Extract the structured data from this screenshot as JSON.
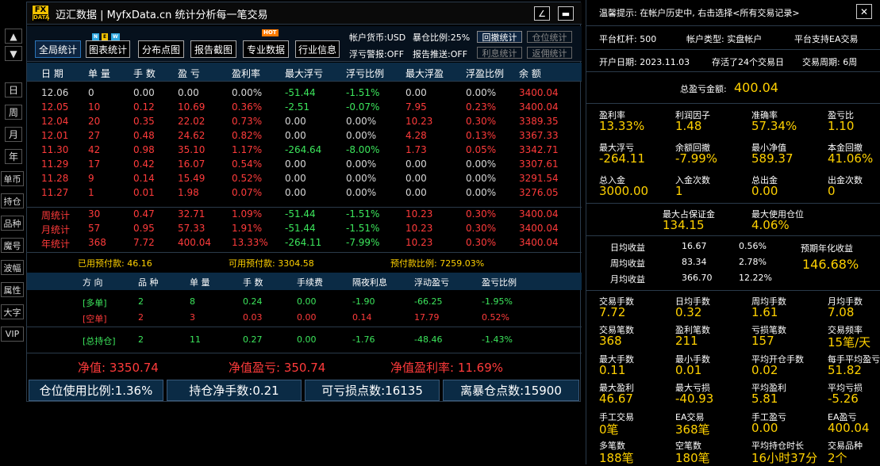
{
  "sidebar": {
    "arrow_up": "▲",
    "arrow_down": "▼",
    "periods": [
      "日",
      "周",
      "月",
      "年"
    ],
    "tools": [
      "单币",
      "持仓",
      "品种",
      "魔号",
      "波幅",
      "属性",
      "大字",
      "VIP"
    ]
  },
  "window": {
    "logo_top": "FX",
    "logo_bottom": "DATA",
    "title": "迈汇数据 | MyfxData.cn  统计分析每一笔交易",
    "min_icon": "∠",
    "max_icon": "▬"
  },
  "toolbar": {
    "buttons": [
      "全局统计",
      "图表统计",
      "分布点图",
      "报告截图",
      "专业数据",
      "行业信息"
    ],
    "new_badge": [
      "N",
      "E",
      "W"
    ],
    "hot_badge": "HOT",
    "currency": "帐户货币:USD",
    "margin_ratio": "暴仓比例:25%",
    "float_alert": "浮亏警报:OFF",
    "report_push": "报告推送:OFF",
    "stat_buttons": [
      "回撤统计",
      "仓位统计",
      "利息统计",
      "返佣统计"
    ]
  },
  "table": {
    "headers": [
      "日 期",
      "单 量",
      "手 数",
      "盈 亏",
      "盈利率",
      "最大浮亏",
      "浮亏比例",
      "最大浮盈",
      "浮盈比例",
      "余 额"
    ],
    "daily": [
      [
        "12.06",
        "0",
        "0.00",
        "0.00",
        "0.00%",
        "-51.44",
        "-1.51%",
        "0.00",
        "0.00%",
        "3400.04"
      ],
      [
        "12.05",
        "10",
        "0.12",
        "10.69",
        "0.36%",
        "-2.51",
        "-0.07%",
        "7.95",
        "0.23%",
        "3400.04"
      ],
      [
        "12.04",
        "20",
        "0.35",
        "22.02",
        "0.73%",
        "0.00",
        "0.00%",
        "10.23",
        "0.30%",
        "3389.35"
      ],
      [
        "12.01",
        "27",
        "0.48",
        "24.62",
        "0.82%",
        "0.00",
        "0.00%",
        "4.28",
        "0.13%",
        "3367.33"
      ],
      [
        "11.30",
        "42",
        "0.98",
        "35.10",
        "1.17%",
        "-264.64",
        "-8.00%",
        "1.73",
        "0.05%",
        "3342.71"
      ],
      [
        "11.29",
        "17",
        "0.42",
        "16.07",
        "0.54%",
        "0.00",
        "0.00%",
        "0.00",
        "0.00%",
        "3307.61"
      ],
      [
        "11.28",
        "9",
        "0.14",
        "15.49",
        "0.52%",
        "0.00",
        "0.00%",
        "0.00",
        "0.00%",
        "3291.54"
      ],
      [
        "11.27",
        "1",
        "0.01",
        "1.98",
        "0.07%",
        "0.00",
        "0.00%",
        "0.00",
        "0.00%",
        "3276.05"
      ]
    ],
    "summary": [
      [
        "周统计",
        "30",
        "0.47",
        "32.71",
        "1.09%",
        "-51.44",
        "-1.51%",
        "10.23",
        "0.30%",
        "3400.04"
      ],
      [
        "月统计",
        "57",
        "0.95",
        "57.33",
        "1.91%",
        "-51.44",
        "-1.51%",
        "10.23",
        "0.30%",
        "3400.04"
      ],
      [
        "年统计",
        "368",
        "7.72",
        "400.04",
        "13.33%",
        "-264.11",
        "-7.99%",
        "10.23",
        "0.30%",
        "3400.04"
      ]
    ],
    "margin_used": "已用预付款: 46.16",
    "margin_free": "可用预付款: 3304.58",
    "margin_ratio": "预付款比例: 7259.03%"
  },
  "positions": {
    "headers": [
      "方 向",
      "品 种",
      "单 量",
      "手 数",
      "手续费",
      "隔夜利息",
      "浮动盈亏",
      "盈亏比例"
    ],
    "rows": [
      [
        "[多单]",
        "2",
        "8",
        "0.24",
        "0.00",
        "-1.90",
        "-66.25",
        "-1.95%"
      ],
      [
        "[空单]",
        "2",
        "3",
        "0.03",
        "0.00",
        "0.14",
        "17.79",
        "0.52%"
      ]
    ],
    "total": [
      "[总持仓]",
      "2",
      "11",
      "0.27",
      "0.00",
      "-1.76",
      "-48.46",
      "-1.43%"
    ]
  },
  "equity": {
    "net": "净值: 3350.74",
    "net_pl": "净值盈亏: 350.74",
    "net_rate": "净值盈利率: 11.69%"
  },
  "bottom": [
    "仓位使用比例:1.36%",
    "持仓净手数:0.21",
    "可亏损点数:16135",
    "离暴仓点数:15900"
  ],
  "right": {
    "tip": "温馨提示: 在帐户历史中, 右击选择<所有交易记录>",
    "close_icon": "✕",
    "leverage": "平台杠杆: 500",
    "acct_type": "帐户类型: 实盘帐户",
    "ea": "平台支持EA交易",
    "open_date": "开户日期: 2023.11.03",
    "days": "存活了24个交易日",
    "period": "交易周期: 6周",
    "total_pl_label": "总盈亏金额:",
    "total_pl": "400.04",
    "grid1": [
      [
        "盈利率",
        "13.33%"
      ],
      [
        "利润因子",
        "1.48"
      ],
      [
        "准确率",
        "57.34%"
      ],
      [
        "盈亏比",
        "1.10"
      ],
      [
        "最大浮亏",
        "-264.11"
      ],
      [
        "余额回撤",
        "-7.99%"
      ],
      [
        "最小净值",
        "589.37"
      ],
      [
        "本金回撤",
        "41.06%"
      ],
      [
        "总入金",
        "3000.00"
      ],
      [
        "入金次数",
        "1"
      ],
      [
        "总出金",
        "0.00"
      ],
      [
        "出金次数",
        "0"
      ]
    ],
    "margin": [
      [
        "最大占保证金",
        "134.15"
      ],
      [
        "最大使用仓位",
        "4.06%"
      ]
    ],
    "avg": [
      [
        "日均收益",
        "16.67",
        "0.56%"
      ],
      [
        "周均收益",
        "83.34",
        "2.78%"
      ],
      [
        "月均收益",
        "366.70",
        "12.22%"
      ]
    ],
    "annual_label": "预期年化收益",
    "annual": "146.68%",
    "grid2": [
      [
        "交易手数",
        "7.72"
      ],
      [
        "日均手数",
        "0.32"
      ],
      [
        "周均手数",
        "1.61"
      ],
      [
        "月均手数",
        "7.08"
      ],
      [
        "交易笔数",
        "368"
      ],
      [
        "盈利笔数",
        "211"
      ],
      [
        "亏损笔数",
        "157"
      ],
      [
        "交易频率",
        "15笔/天"
      ],
      [
        "最大手数",
        "0.11"
      ],
      [
        "最小手数",
        "0.01"
      ],
      [
        "平均开仓手数",
        "0.02"
      ],
      [
        "每手平均盈亏",
        "51.82"
      ],
      [
        "最大盈利",
        "46.67"
      ],
      [
        "最大亏损",
        "-40.93"
      ],
      [
        "平均盈利",
        "5.81"
      ],
      [
        "平均亏损",
        "-5.26"
      ],
      [
        "手工交易",
        "0笔"
      ],
      [
        "EA交易",
        "368笔"
      ],
      [
        "手工盈亏",
        "0.00"
      ],
      [
        "EA盈亏",
        "400.04"
      ],
      [
        "多笔数",
        "188笔"
      ],
      [
        "空笔数",
        "180笔"
      ],
      [
        "平均持仓时长",
        "16小时37分"
      ],
      [
        "交易品种",
        "2个"
      ]
    ]
  }
}
